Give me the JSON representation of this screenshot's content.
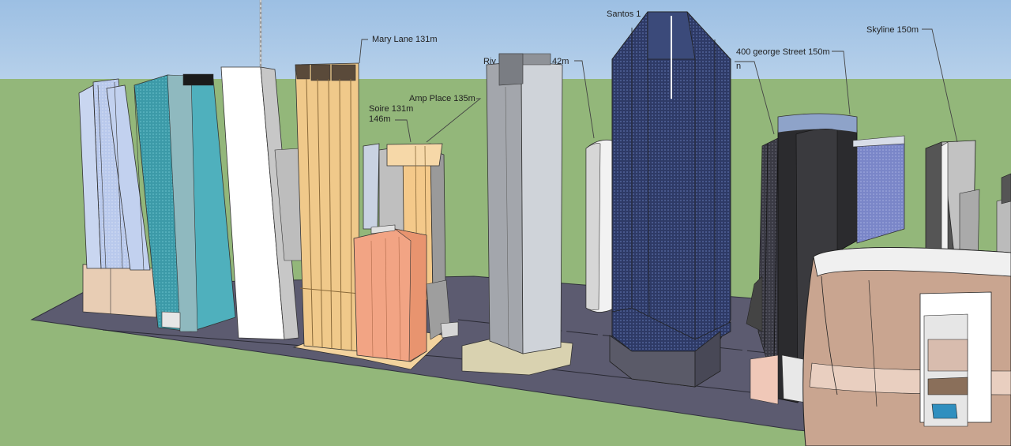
{
  "viewport": {
    "sky_color": "#a9c7e6",
    "ground_color": "#93b77a",
    "road_color": "#5c5b70"
  },
  "labels": {
    "mary_lane": "Mary Lane 131m",
    "amp_place": "Amp Place 135m",
    "soire": "Soire 131m",
    "soire_second": "146m",
    "river_fragment": "Riv",
    "river_height_fragment": "42m",
    "santos": "Santos 1",
    "george_400": "400 george Street 150m",
    "george_fragment": "n",
    "skyline": "Skyline 150m"
  },
  "buildings": [
    {
      "name": "pale-blue-tower"
    },
    {
      "name": "teal-tower"
    },
    {
      "name": "white-tower-with-spire"
    },
    {
      "name": "mary-lane-tower"
    },
    {
      "name": "soire-tower"
    },
    {
      "name": "salmon-podium"
    },
    {
      "name": "grey-central-tower"
    },
    {
      "name": "white-cylinder-tower"
    },
    {
      "name": "santos-tower"
    },
    {
      "name": "dark-ribbed-tower"
    },
    {
      "name": "george-400-tower"
    },
    {
      "name": "blue-box-tower"
    },
    {
      "name": "skyline-tower"
    },
    {
      "name": "curved-podium"
    }
  ]
}
